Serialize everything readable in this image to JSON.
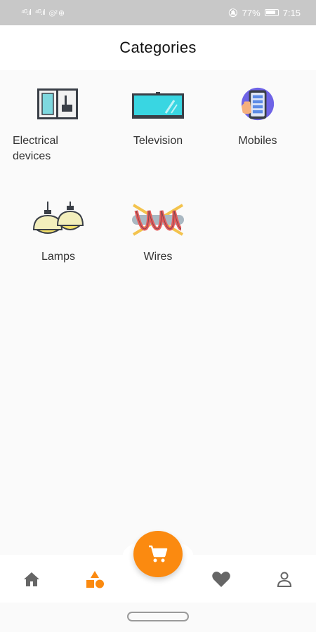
{
  "status_bar": {
    "signal_1": "⁴ᴳ.ıl",
    "signal_2": "⁴ᴳ.ıl",
    "extra": "◎² ⊛",
    "mute": "🔕",
    "battery": "77%",
    "time": "7:15"
  },
  "header": {
    "title": "Categories"
  },
  "categories": [
    {
      "label": "Electrical devices",
      "icon": "refrigerator-icon"
    },
    {
      "label": "Television",
      "icon": "television-icon"
    },
    {
      "label": "Mobiles",
      "icon": "mobile-phone-icon"
    },
    {
      "label": "Lamps",
      "icon": "lamps-icon"
    },
    {
      "label": "Wires",
      "icon": "wires-icon"
    }
  ],
  "bottom_nav": {
    "items": [
      {
        "icon": "home-icon",
        "active": false
      },
      {
        "icon": "categories-icon",
        "active": true
      },
      {
        "icon": "heart-icon",
        "active": false
      },
      {
        "icon": "profile-icon",
        "active": false
      }
    ],
    "fab_icon": "cart-icon"
  },
  "colors": {
    "accent": "#fb8a10",
    "nav_inactive": "#666666",
    "background": "#fafafa"
  }
}
